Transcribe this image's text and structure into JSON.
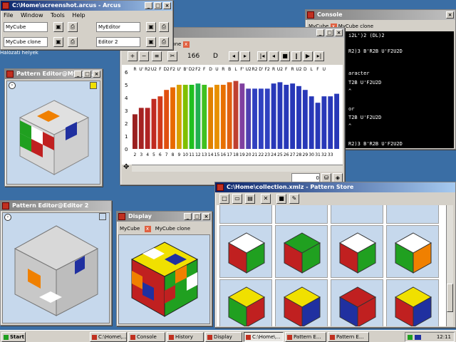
{
  "main_window": {
    "title": "C:\\Home\\screenshot.arcus - Arcus",
    "menu": [
      "File",
      "Window",
      "Tools",
      "Help"
    ],
    "fields": [
      "MyCube",
      "MyEditor",
      "MyCube clone",
      "Editor 2"
    ]
  },
  "desktop_label": "Hálózati helyek",
  "console": {
    "title": "Console",
    "tabs": [
      "MyCube",
      "MyCube clone"
    ],
    "lines": [
      "i2L')2 (DL)2",
      "R2)3 B'R2B U'F2U2D",
      "aracter",
      "T2B U'F2U2D",
      "^",
      "or",
      "T2B U'F2U2D",
      "^",
      "R2)3 B'R2B U'F2U2D"
    ]
  },
  "pattern_editor1": {
    "title": "Pattern Editor@MyEdi..."
  },
  "pattern_editor2": {
    "title": "Pattern Editor@Editor 2"
  },
  "display": {
    "title": "Display",
    "tabs": [
      "MyCube",
      "MyCube clone"
    ]
  },
  "chart_window": {
    "tab": "e clone",
    "count": "166",
    "face": "D",
    "status_value": "0"
  },
  "chart_data": {
    "type": "bar",
    "ylim": [
      0,
      6
    ],
    "yticks": [
      "0",
      "1",
      "2",
      "3",
      "4",
      "5",
      "6"
    ],
    "categories": [
      "2",
      "3",
      "4",
      "5",
      "6",
      "7",
      "8",
      "9",
      "10",
      "11",
      "12",
      "13",
      "14",
      "15",
      "16",
      "17",
      "18",
      "19",
      "20",
      "21",
      "22",
      "23",
      "24",
      "25",
      "26",
      "27",
      "28",
      "29",
      "30",
      "31",
      "32",
      "33"
    ],
    "moves": [
      "R",
      "U'",
      "R2",
      "U2",
      "F",
      "D2",
      "F2",
      "U'",
      "B'",
      "D2",
      "F2",
      "F",
      "D",
      "U",
      "R",
      "B",
      "L",
      "F'",
      "U2",
      "R2",
      "D'",
      "F2",
      "R",
      "U2",
      "F",
      "R",
      "U2",
      "D",
      "L",
      "F",
      "U"
    ],
    "values": [
      2.7,
      3.2,
      3.2,
      3.9,
      4.1,
      4.6,
      4.8,
      5.0,
      5.0,
      5.0,
      5.1,
      5.0,
      4.8,
      5.0,
      5.0,
      5.2,
      5.3,
      5.1,
      4.7,
      4.7,
      4.7,
      4.7,
      5.1,
      5.2,
      5.0,
      5.1,
      4.9,
      4.6,
      4.1,
      3.6,
      4.1,
      4.1,
      4.3
    ],
    "colors": [
      "#9a2020",
      "#a52222",
      "#b02424",
      "#c02a20",
      "#d03a1a",
      "#e05010",
      "#e86a00",
      "#d8a000",
      "#80c000",
      "#20c020",
      "#20b050",
      "#40c020",
      "#e08000",
      "#e89000",
      "#e87000",
      "#e06010",
      "#c04030",
      "#8040a0",
      "#5040b0",
      "#3040c0",
      "#3040c0",
      "#3040c0",
      "#2838b8",
      "#2838b8",
      "#2838b8",
      "#2838b8",
      "#2838b8",
      "#2838b8",
      "#2838b8",
      "#2838b8",
      "#2838b8",
      "#2838b8",
      "#2838b8"
    ]
  },
  "pattern_store": {
    "title": "C:\\Home\\collection.xmlz - Pattern Store"
  },
  "taskbar": {
    "start": "Start",
    "buttons": [
      "C:\\Home\\...",
      "Console",
      "History",
      "Display",
      "C:\\Home\\...",
      "Pattern E...",
      "Pattern E..."
    ],
    "clock": "12:11"
  },
  "colors": {
    "accent": "#0a246a",
    "desktop": "#3a6ea5"
  }
}
